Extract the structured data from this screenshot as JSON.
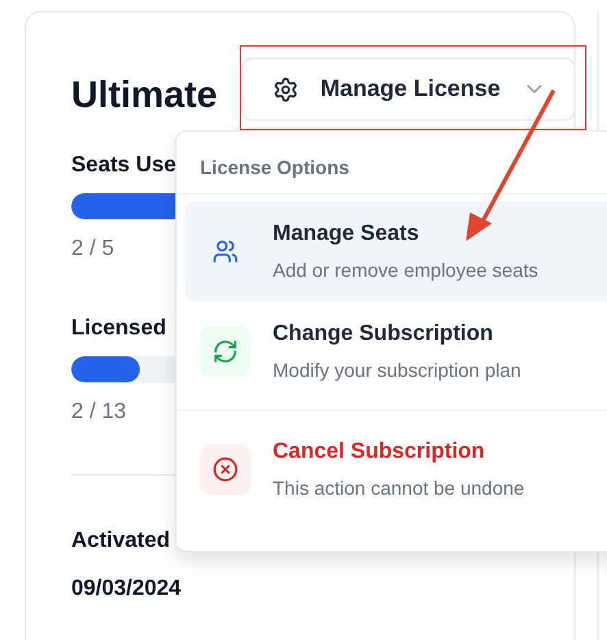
{
  "card": {
    "title": "Ultimate",
    "metrics": [
      {
        "label": "Seats Use",
        "level": 0.4,
        "reading": "2 / 5"
      },
      {
        "label": "Licensed",
        "level": 0.15,
        "reading": "2 / 13"
      }
    ],
    "activated": {
      "label": "Activated",
      "value": "09/03/2024"
    }
  },
  "manage_button": {
    "label": "Manage License"
  },
  "menu": {
    "header": "License Options",
    "items": [
      {
        "kind": "seats",
        "title": "Manage Seats",
        "subtitle": "Add or remove employee seats",
        "selected": true
      },
      {
        "kind": "subscription",
        "title": "Change Subscription",
        "subtitle": "Modify your subscription plan",
        "selected": false
      },
      {
        "kind": "cancel",
        "title": "Cancel Subscription",
        "subtitle": "This action cannot be undone",
        "selected": false
      }
    ]
  }
}
